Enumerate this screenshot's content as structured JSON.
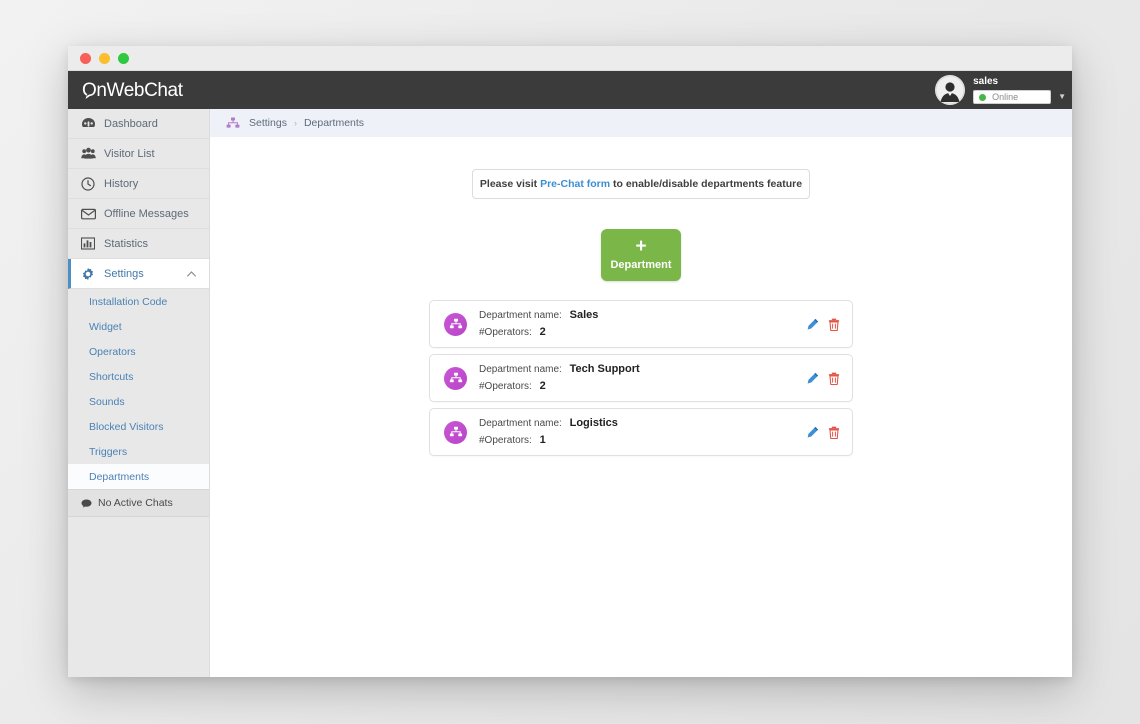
{
  "window": {
    "traffic_lights": [
      "close",
      "minimize",
      "maximize"
    ]
  },
  "header": {
    "logo_text": "OnWebChat",
    "user": {
      "name": "sales",
      "status": "Online",
      "status_color": "#46b645",
      "avatar_icon": "user-avatar-icon",
      "caret_icon": "chevron-down-icon"
    }
  },
  "sidebar": {
    "items": [
      {
        "label": "Dashboard",
        "icon": "dashboard-icon",
        "active": false
      },
      {
        "label": "Visitor List",
        "icon": "visitors-icon",
        "active": false
      },
      {
        "label": "History",
        "icon": "clock-icon",
        "active": false
      },
      {
        "label": "Offline Messages",
        "icon": "envelope-icon",
        "active": false
      },
      {
        "label": "Statistics",
        "icon": "bar-chart-icon",
        "active": false
      },
      {
        "label": "Settings",
        "icon": "gear-icon",
        "active": true,
        "expanded": true,
        "chevron": "chevron-up-icon"
      }
    ],
    "settings_subitems": [
      {
        "label": "Installation Code",
        "active": false
      },
      {
        "label": "Widget",
        "active": false
      },
      {
        "label": "Operators",
        "active": false
      },
      {
        "label": "Shortcuts",
        "active": false
      },
      {
        "label": "Sounds",
        "active": false
      },
      {
        "label": "Blocked Visitors",
        "active": false
      },
      {
        "label": "Triggers",
        "active": false
      },
      {
        "label": "Departments",
        "active": true
      }
    ],
    "active_chats": {
      "label": "No Active Chats",
      "icon": "chat-bubble-icon"
    },
    "accent_color": "#4a90c4"
  },
  "breadcrumb": {
    "icon": "org-chart-icon",
    "items": [
      "Settings",
      "Departments"
    ],
    "separator": "›"
  },
  "notice": {
    "prefix": "Please visit",
    "link": "Pre-Chat form",
    "suffix": "to enable/disable departments feature"
  },
  "add_button": {
    "plus": "+",
    "label": "Department",
    "color": "#7ab648"
  },
  "cards": {
    "name_label": "Department name:",
    "operators_label": "#Operators:",
    "edit_icon": "pencil-icon",
    "delete_icon": "trash-icon",
    "avatar_icon": "org-chart-icon",
    "items": [
      {
        "name": "Sales",
        "operators": "2"
      },
      {
        "name": "Tech Support",
        "operators": "2"
      },
      {
        "name": "Logistics",
        "operators": "1"
      }
    ]
  }
}
